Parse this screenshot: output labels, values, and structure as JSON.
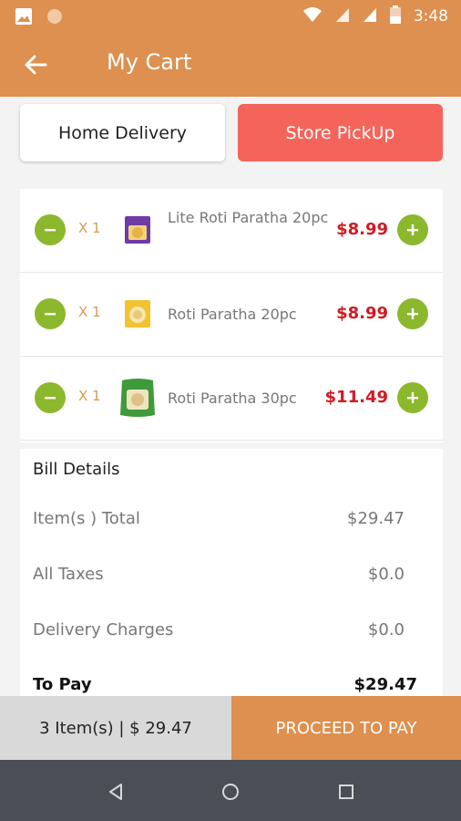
{
  "status_bar": {
    "time": "3:48"
  },
  "app_bar": {
    "title": "My Cart"
  },
  "tabs": {
    "home_delivery": "Home Delivery",
    "store_pickup": "Store PickUp"
  },
  "cart_items": [
    {
      "qty": "X 1",
      "name": "Lite Roti Paratha 20pc",
      "price": "$8.99"
    },
    {
      "qty": "X 1",
      "name": "Roti Paratha 20pc",
      "price": "$8.99"
    },
    {
      "qty": "X 1",
      "name": "Roti Paratha 30pc",
      "price": "$11.49"
    }
  ],
  "bill": {
    "title": "Bill Details",
    "rows": [
      {
        "label": "Item(s ) Total",
        "value": "$29.47"
      },
      {
        "label": "All Taxes",
        "value": "$0.0"
      },
      {
        "label": "Delivery Charges",
        "value": "$0.0"
      }
    ],
    "to_pay_label": "To Pay",
    "to_pay_value": "$29.47"
  },
  "footer": {
    "summary": "3 Item(s) | $ 29.47",
    "proceed": "PROCEED TO PAY"
  },
  "colors": {
    "brand": "#dd904f",
    "pickup_tab": "#f5645a",
    "qty_button": "#8cb82d",
    "price": "#d11a22",
    "nav_bar": "#4a4e55"
  }
}
